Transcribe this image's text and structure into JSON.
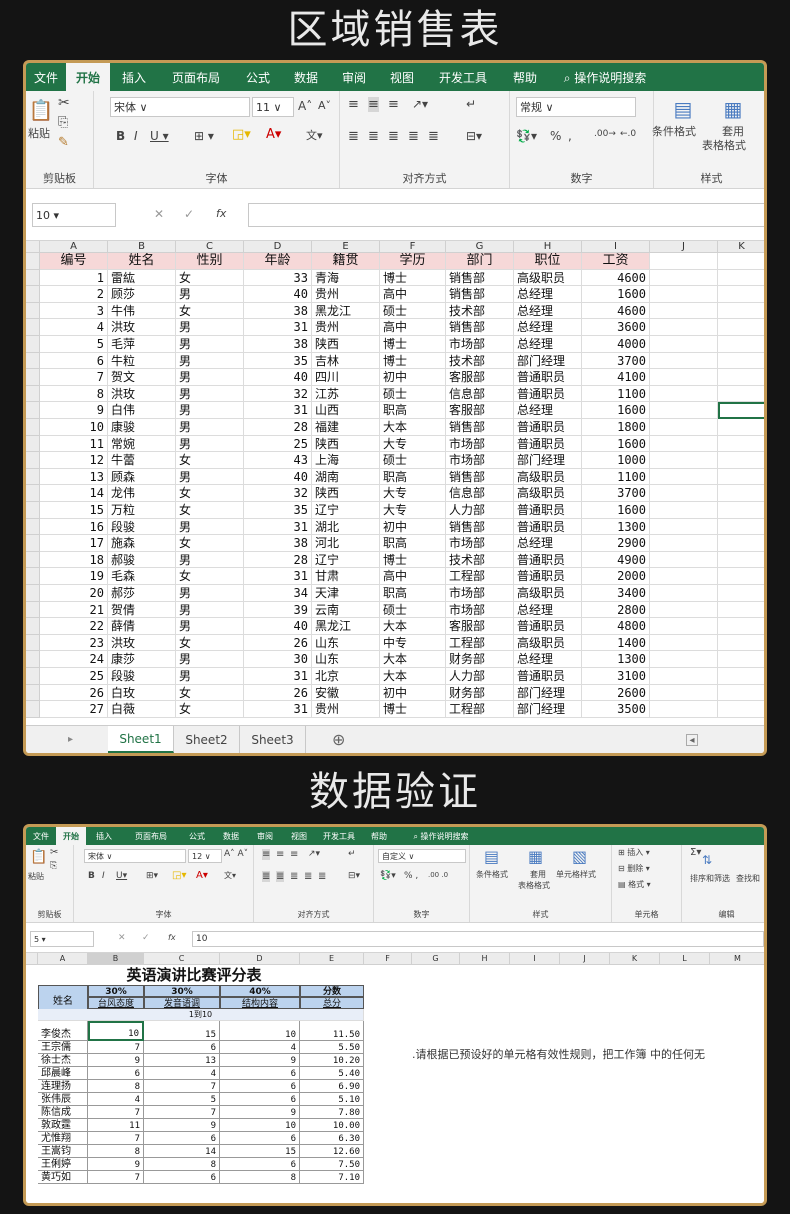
{
  "section1_title": "区域销售表",
  "section2_title": "数据验证",
  "s1": {
    "tabs": [
      "文件",
      "开始",
      "插入",
      "页面布局",
      "公式",
      "数据",
      "审阅",
      "视图",
      "开发工具",
      "帮助",
      "操作说明搜索"
    ],
    "font_name": "宋体",
    "font_size": "11",
    "number_format": "常规",
    "group_clipboard": "剪贴板",
    "group_font": "字体",
    "group_align": "对齐方式",
    "group_number": "数字",
    "group_style": "样式",
    "paste_label": "粘贴",
    "cond_format": "条件格式",
    "table_format_1": "套用",
    "table_format_2": "表格格式",
    "name_box": "10",
    "fx": "fx",
    "col_letters": [
      "A",
      "B",
      "C",
      "D",
      "E",
      "F",
      "G",
      "H",
      "I",
      "J",
      "K"
    ],
    "headers": [
      "编号",
      "姓名",
      "性别",
      "年龄",
      "籍贯",
      "学历",
      "部门",
      "职位",
      "工资"
    ],
    "rows": [
      [
        "1",
        "雷紘",
        "女",
        "33",
        "青海",
        "博士",
        "销售部",
        "高级职员",
        "4600"
      ],
      [
        "2",
        "顾莎",
        "男",
        "40",
        "贵州",
        "高中",
        "销售部",
        "总经理",
        "1600"
      ],
      [
        "3",
        "牛伟",
        "女",
        "38",
        "黑龙江",
        "硕士",
        "技术部",
        "总经理",
        "4600"
      ],
      [
        "4",
        "洪玫",
        "男",
        "31",
        "贵州",
        "高中",
        "销售部",
        "总经理",
        "3600"
      ],
      [
        "5",
        "毛萍",
        "男",
        "38",
        "陕西",
        "博士",
        "市场部",
        "总经理",
        "4000"
      ],
      [
        "6",
        "牛粒",
        "男",
        "35",
        "吉林",
        "博士",
        "技术部",
        "部门经理",
        "3700"
      ],
      [
        "7",
        "贺文",
        "男",
        "40",
        "四川",
        "初中",
        "客服部",
        "普通职员",
        "4100"
      ],
      [
        "8",
        "洪玫",
        "男",
        "32",
        "江苏",
        "硕士",
        "信息部",
        "普通职员",
        "1100"
      ],
      [
        "9",
        "白伟",
        "男",
        "31",
        "山西",
        "职高",
        "客服部",
        "总经理",
        "1600"
      ],
      [
        "10",
        "康骏",
        "男",
        "28",
        "福建",
        "大本",
        "销售部",
        "普通职员",
        "1800"
      ],
      [
        "11",
        "常婉",
        "男",
        "25",
        "陕西",
        "大专",
        "市场部",
        "普通职员",
        "1600"
      ],
      [
        "12",
        "牛蕾",
        "女",
        "43",
        "上海",
        "硕士",
        "市场部",
        "部门经理",
        "1000"
      ],
      [
        "13",
        "顾森",
        "男",
        "40",
        "湖南",
        "职高",
        "销售部",
        "高级职员",
        "1100"
      ],
      [
        "14",
        "龙伟",
        "女",
        "32",
        "陕西",
        "大专",
        "信息部",
        "高级职员",
        "3700"
      ],
      [
        "15",
        "万粒",
        "女",
        "35",
        "辽宁",
        "大专",
        "人力部",
        "普通职员",
        "1600"
      ],
      [
        "16",
        "段骏",
        "男",
        "31",
        "湖北",
        "初中",
        "销售部",
        "普通职员",
        "1300"
      ],
      [
        "17",
        "施森",
        "女",
        "38",
        "河北",
        "职高",
        "市场部",
        "总经理",
        "2900"
      ],
      [
        "18",
        "郝骏",
        "男",
        "28",
        "辽宁",
        "博士",
        "技术部",
        "普通职员",
        "4900"
      ],
      [
        "19",
        "毛森",
        "女",
        "31",
        "甘肃",
        "高中",
        "工程部",
        "普通职员",
        "2000"
      ],
      [
        "20",
        "郝莎",
        "男",
        "34",
        "天津",
        "职高",
        "市场部",
        "高级职员",
        "3400"
      ],
      [
        "21",
        "贺倩",
        "男",
        "39",
        "云南",
        "硕士",
        "市场部",
        "总经理",
        "2800"
      ],
      [
        "22",
        "薛倩",
        "男",
        "40",
        "黑龙江",
        "大本",
        "客服部",
        "普通职员",
        "4800"
      ],
      [
        "23",
        "洪玫",
        "女",
        "26",
        "山东",
        "中专",
        "工程部",
        "高级职员",
        "1400"
      ],
      [
        "24",
        "康莎",
        "男",
        "30",
        "山东",
        "大本",
        "财务部",
        "总经理",
        "1300"
      ],
      [
        "25",
        "段骏",
        "男",
        "31",
        "北京",
        "大本",
        "人力部",
        "普通职员",
        "3100"
      ],
      [
        "26",
        "白玫",
        "女",
        "26",
        "安徽",
        "初中",
        "财务部",
        "部门经理",
        "2600"
      ],
      [
        "27",
        "白薇",
        "女",
        "31",
        "贵州",
        "博士",
        "工程部",
        "部门经理",
        "3500"
      ]
    ],
    "sheets": [
      "Sheet1",
      "Sheet2",
      "Sheet3"
    ]
  },
  "s2": {
    "tabs": [
      "文件",
      "开始",
      "插入",
      "页面布局",
      "公式",
      "数据",
      "审阅",
      "视图",
      "开发工具",
      "帮助",
      "操作说明搜索"
    ],
    "font_name": "宋体",
    "font_size": "12",
    "number_format": "自定义",
    "group_clipboard": "剪贴板",
    "group_font": "字体",
    "group_align": "对齐方式",
    "group_number": "数字",
    "group_style": "样式",
    "group_cells": "单元格",
    "group_edit": "编辑",
    "paste_label": "粘贴",
    "cond_format": "条件格式",
    "table_format_1": "套用",
    "table_format_2": "表格格式",
    "cell_style": "单元格样式",
    "insert": "插入",
    "delete": "删除",
    "format": "格式",
    "sort_filter": "排序和筛选",
    "find": "查找和",
    "name_box": "5",
    "formula_value": "10",
    "fx": "fx",
    "col_letters": [
      "A",
      "B",
      "C",
      "D",
      "E",
      "F",
      "G",
      "H",
      "I",
      "J",
      "K",
      "L",
      "M"
    ],
    "table_title": "英语演讲比赛评分表",
    "name_header": "姓名",
    "pct": [
      "30%",
      "30%",
      "40%",
      "分数"
    ],
    "crit": [
      "台风态度",
      "发音语调",
      "结构内容",
      "总分"
    ],
    "range_note": "1到10",
    "instruction": ".请根据已预设好的单元格有效性规则，把工作簿 中的任何无",
    "rows": [
      [
        "李俊杰",
        "10",
        "15",
        "10",
        "11.50"
      ],
      [
        "王宗儒",
        "7",
        "6",
        "4",
        "5.50"
      ],
      [
        "徐士杰",
        "9",
        "13",
        "9",
        "10.20"
      ],
      [
        "邱晨峰",
        "6",
        "4",
        "6",
        "5.40"
      ],
      [
        "连理扬",
        "8",
        "7",
        "6",
        "6.90"
      ],
      [
        "张伟辰",
        "4",
        "5",
        "6",
        "5.10"
      ],
      [
        "陈信成",
        "7",
        "7",
        "9",
        "7.80"
      ],
      [
        "敦政霆",
        "11",
        "9",
        "10",
        "10.00"
      ],
      [
        "尤惟翔",
        "7",
        "6",
        "6",
        "6.30"
      ],
      [
        "王嵩钧",
        "8",
        "14",
        "15",
        "12.60"
      ],
      [
        "王俐婷",
        "9",
        "8",
        "6",
        "7.50"
      ],
      [
        "黄巧如",
        "7",
        "6",
        "8",
        "7.10"
      ]
    ]
  }
}
